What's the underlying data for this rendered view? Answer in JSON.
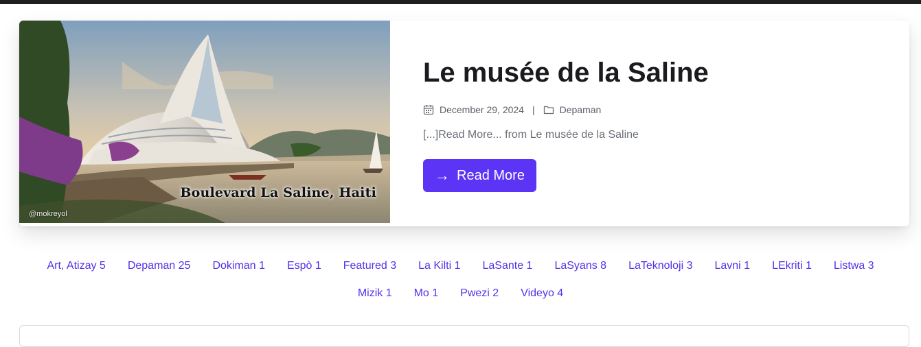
{
  "post": {
    "title": "Le musée de la Saline",
    "date": "December 29, 2024",
    "separator": "|",
    "category": "Depaman",
    "excerpt": "[...]Read More... from Le musée de la Saline",
    "read_more_label": "Read More",
    "image": {
      "caption": "Boulevard La Saline, Haiti",
      "credit": "@mokreyol"
    }
  },
  "categories": [
    {
      "label": "Art, Atizay 5"
    },
    {
      "label": "Depaman 25"
    },
    {
      "label": "Dokiman 1"
    },
    {
      "label": "Espò 1"
    },
    {
      "label": "Featured 3"
    },
    {
      "label": "La Kilti 1"
    },
    {
      "label": "LaSante 1"
    },
    {
      "label": "LaSyans 8"
    },
    {
      "label": "LaTeknoloji 3"
    },
    {
      "label": "Lavni 1"
    },
    {
      "label": "LEkriti 1"
    },
    {
      "label": "Listwa 3"
    },
    {
      "label": "Mizik 1"
    },
    {
      "label": "Mo 1"
    },
    {
      "label": "Pwezi 2"
    },
    {
      "label": "Videyo 4"
    }
  ],
  "colors": {
    "accent": "#5b34f5",
    "link": "#5530e8",
    "title": "#1b1b1f"
  },
  "icons": {
    "date": "calendar-icon",
    "category": "folder-icon",
    "button": "arrow-right-icon"
  }
}
